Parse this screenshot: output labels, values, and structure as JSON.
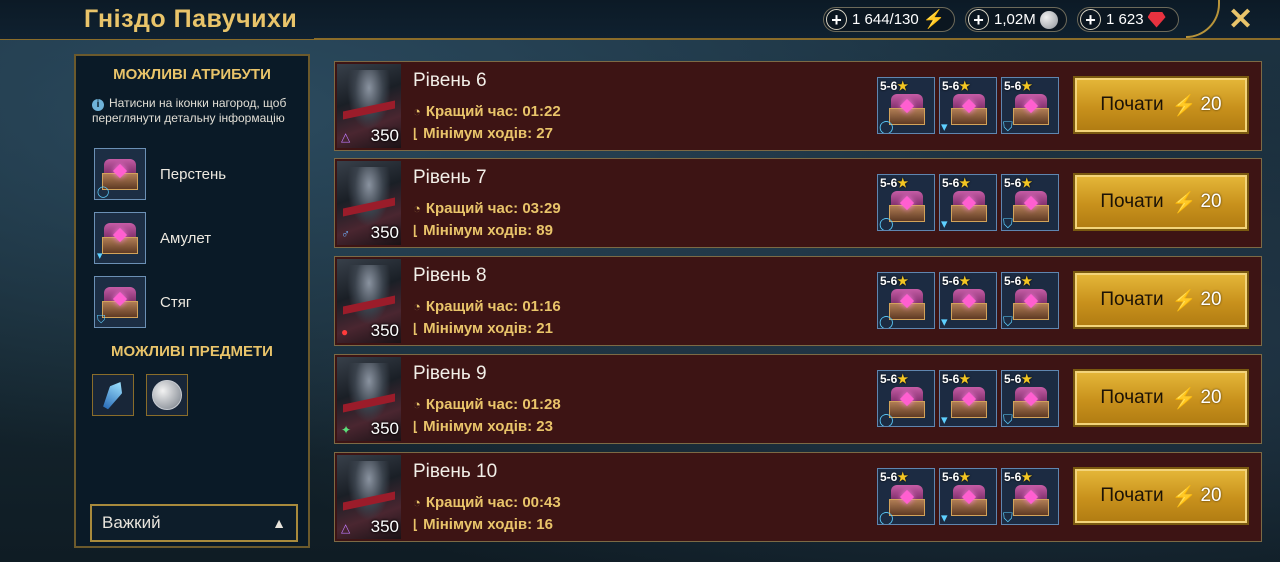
{
  "header": {
    "title": "Гніздо Павучихи",
    "energy": "1 644/130",
    "silver": "1,02M",
    "gems": "1 623"
  },
  "sidebar": {
    "attributes_heading": "МОЖЛИВІ АТРИБУТИ",
    "info_text": "Натисни на іконки нагород, щоб переглянути детальну інформацію",
    "attributes": [
      {
        "label": "Перстень",
        "icon": "ring-icon"
      },
      {
        "label": "Амулет",
        "icon": "amulet-icon"
      },
      {
        "label": "Стяг",
        "icon": "banner-icon"
      }
    ],
    "items_heading": "МОЖЛИВІ ПРЕДМЕТИ",
    "items": [
      "shard-icon",
      "silver-coin-icon"
    ],
    "difficulty": "Важкий"
  },
  "levels": [
    {
      "name": "Рівень 6",
      "best_time": "Кращий час: 01:22",
      "min_moves": "Мінімум ходів: 27",
      "power": "350",
      "affinity": "magic"
    },
    {
      "name": "Рівень 7",
      "best_time": "Кращий час: 03:29",
      "min_moves": "Мінімум ходів: 89",
      "power": "350",
      "affinity": "void"
    },
    {
      "name": "Рівень 8",
      "best_time": "Кращий час: 01:16",
      "min_moves": "Мінімум ходів: 21",
      "power": "350",
      "affinity": "force"
    },
    {
      "name": "Рівень 9",
      "best_time": "Кращий час: 01:28",
      "min_moves": "Мінімум ходів: 23",
      "power": "350",
      "affinity": "spirit"
    },
    {
      "name": "Рівень 10",
      "best_time": "Кращий час: 00:43",
      "min_moves": "Мінімум ходів: 16",
      "power": "350",
      "affinity": "magic"
    }
  ],
  "reward_stars": "5-6",
  "start_label": "Почати",
  "start_cost": "20",
  "colors": {
    "accent": "#e9c46a",
    "row_bg": "#3d1414",
    "button": "#d4a02a"
  }
}
